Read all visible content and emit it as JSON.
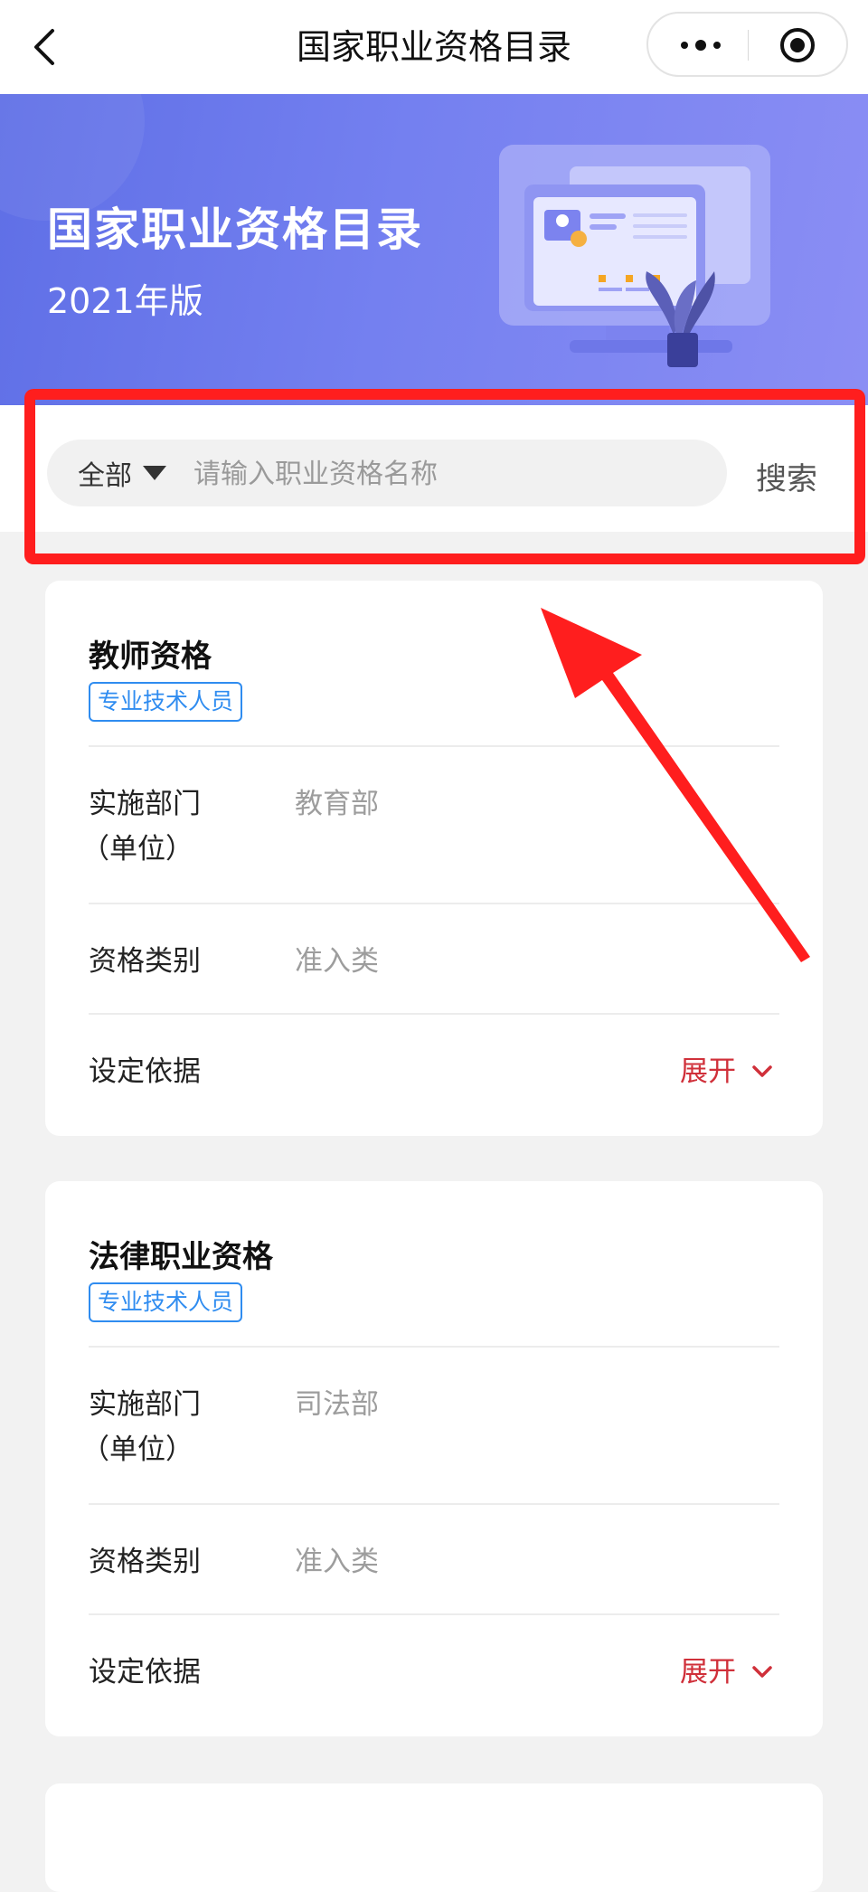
{
  "nav": {
    "title": "国家职业资格目录"
  },
  "banner": {
    "title": "国家职业资格目录",
    "subtitle": "2021年版"
  },
  "search": {
    "scope": "全部",
    "placeholder": "请输入职业资格名称",
    "button": "搜索"
  },
  "cards": [
    {
      "title": "教师资格",
      "tag": "专业技术人员",
      "dept_label_line1": "实施部门",
      "dept_label_line2": "（单位）",
      "dept_value": "教育部",
      "category_label": "资格类别",
      "category_value": "准入类",
      "basis_label": "设定依据",
      "expand_label": "展开"
    },
    {
      "title": "法律职业资格",
      "tag": "专业技术人员",
      "dept_label_line1": "实施部门",
      "dept_label_line2": "（单位）",
      "dept_value": "司法部",
      "category_label": "资格类别",
      "category_value": "准入类",
      "basis_label": "设定依据",
      "expand_label": "展开"
    }
  ],
  "colors": {
    "accent_red": "#d0303a",
    "tag_blue": "#2f8cf0",
    "banner_blue": "#6b78ec",
    "highlight_red": "#ff1e1e"
  },
  "icons": [
    "back-icon",
    "more-icon",
    "target-icon",
    "caret-down-icon",
    "chevron-down-icon"
  ]
}
